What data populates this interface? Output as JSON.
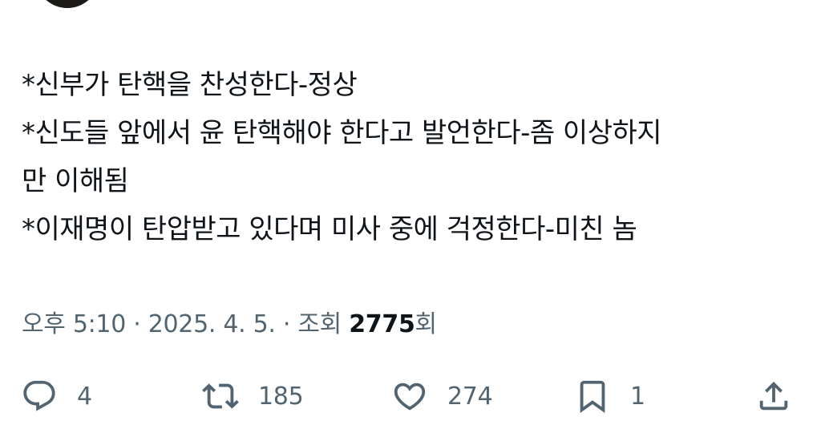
{
  "tweet": {
    "lines": [
      "*신부가 탄핵을 찬성한다-정상",
      "*신도들 앞에서 윤 탄핵해야 한다고 발언한다-좀 이상하지",
      "만 이해됨",
      "*이재명이 탄압받고 있다며 미사 중에 걱정한다-미친 놈"
    ]
  },
  "meta": {
    "time": "오후 5:10",
    "separator": " · ",
    "date": "2025. 4. 5.",
    "views_label": "조회",
    "views_count": "2775",
    "views_suffix": "회"
  },
  "actions": {
    "reply": {
      "icon": "reply-icon",
      "count": "4"
    },
    "retweet": {
      "icon": "retweet-icon",
      "count": "185"
    },
    "like": {
      "icon": "heart-icon",
      "count": "274"
    },
    "bookmark": {
      "icon": "bookmark-icon",
      "count": "1"
    },
    "share": {
      "icon": "share-icon"
    }
  },
  "colors": {
    "text": "#0f1419",
    "muted": "#536471",
    "background": "#ffffff"
  }
}
